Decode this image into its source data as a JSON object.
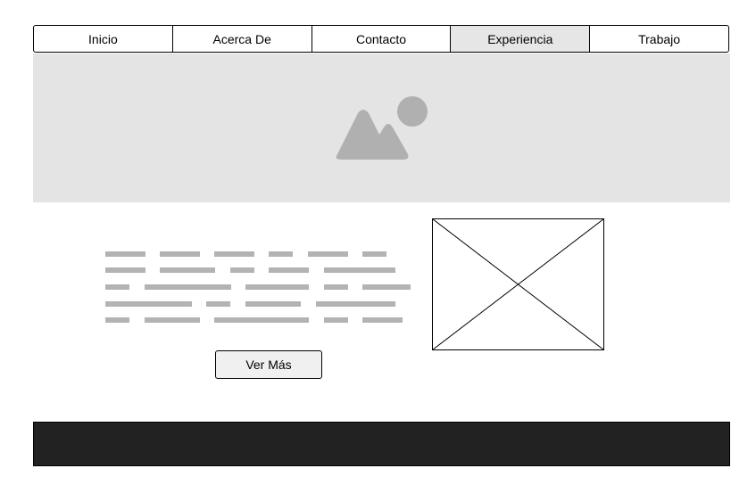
{
  "nav": {
    "items": [
      {
        "label": "Inicio"
      },
      {
        "label": "Acerca De"
      },
      {
        "label": "Contacto"
      },
      {
        "label": "Experiencia",
        "active": true
      },
      {
        "label": "Trabajo"
      }
    ]
  },
  "hero": {
    "icon": "image-placeholder-icon",
    "background": "#e4e4e4",
    "icon_color": "#b0b0b0"
  },
  "content": {
    "text_line_color": "#b3b3b3",
    "button_label": "Ver Más"
  },
  "media": {
    "icon": "image-placeholder-icon"
  },
  "footer": {
    "background": "#222222"
  }
}
